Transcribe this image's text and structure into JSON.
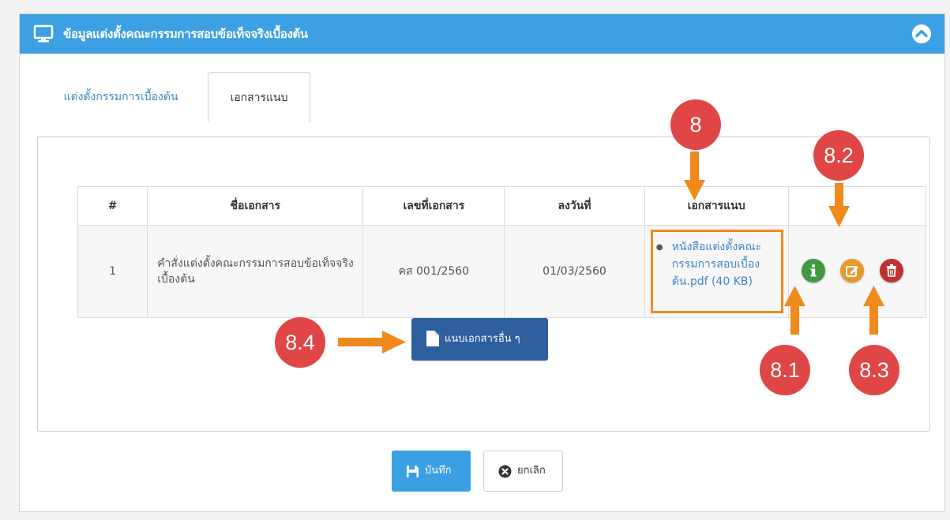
{
  "panel": {
    "title": "ข้อมูลแต่งตั้งคณะกรรมการสอบข้อเท็จจริงเบื้องต้น",
    "header_color": "#3da0e3"
  },
  "tabs": [
    {
      "label": "แต่งตั้งกรรมการเบื้องต้น",
      "active": false
    },
    {
      "label": "เอกสารแนบ",
      "active": true
    }
  ],
  "table": {
    "headers": [
      "#",
      "ชื่อเอกสาร",
      "เลขที่เอกสาร",
      "ลงวันที่",
      "เอกสารแนบ",
      ""
    ],
    "rows": [
      {
        "num": "1",
        "name": "คำสั่งแต่งตั้งคณะกรรมการสอบข้อเท็จจริงเบื้องต้น",
        "doc_no": "คส 001/2560",
        "date": "01/03/2560",
        "attachment": "หนังสือแต่งตั้งคณะกรรมการสอบเบื้องต้น.pdf (40 KB)",
        "actions": [
          {
            "icon": "info-icon",
            "color": "#3f9a3f"
          },
          {
            "icon": "edit-icon",
            "color": "#e69a2e"
          },
          {
            "icon": "trash-icon",
            "color": "#c23131"
          }
        ]
      }
    ]
  },
  "buttons": {
    "attach_other": "แนบเอกสารอื่น ๆ",
    "save": "บันทึก",
    "cancel": "ยกเลิก"
  },
  "callouts": {
    "c8": "8",
    "c81": "8.1",
    "c82": "8.2",
    "c83": "8.3",
    "c84": "8.4",
    "color": "#e04646",
    "arrow_color": "#f08a1d"
  }
}
